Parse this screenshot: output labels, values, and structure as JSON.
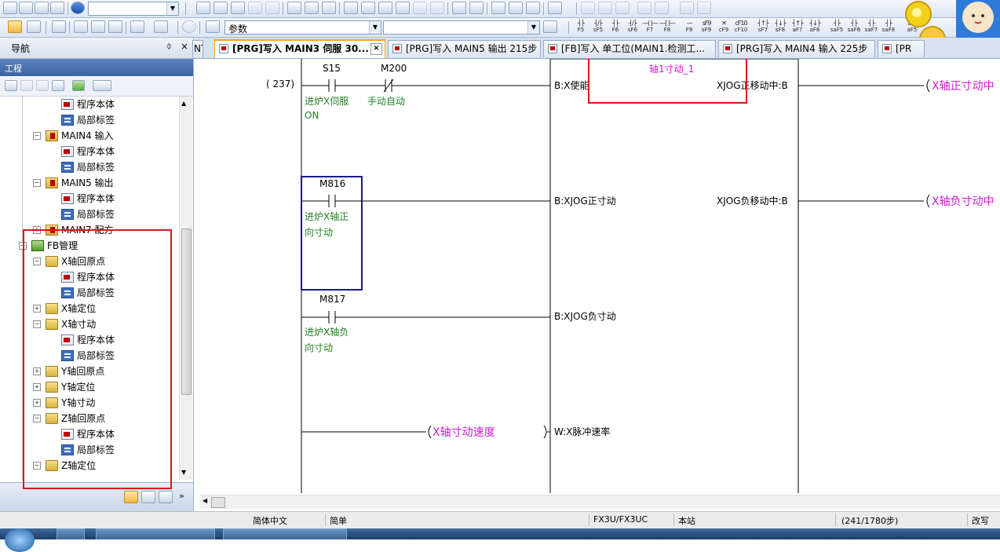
{
  "toolbar": {
    "combo1_value": "",
    "combo2_value": "参数",
    "combo3_value": "",
    "fkeys": [
      "F5",
      "sF5",
      "F6",
      "sF6",
      "F7",
      "F8",
      "F9",
      "sF9",
      "cF9",
      "cF10",
      "sF7",
      "sF8",
      "aF7",
      "aF8",
      "saF5",
      "saF6",
      "saF7",
      "saF8",
      "aF5"
    ]
  },
  "nav": {
    "title": "导航",
    "pin_icon": "pin-icon",
    "close_icon": "close-icon",
    "project_label": "工程",
    "tree": [
      {
        "label": "程序本体",
        "icon": "program-body-icon"
      },
      {
        "label": "局部标签",
        "icon": "local-label-icon"
      },
      {
        "label": "MAIN4 输入",
        "icon": "program-icon"
      },
      {
        "label": "程序本体",
        "icon": "program-body-icon"
      },
      {
        "label": "局部标签",
        "icon": "local-label-icon"
      },
      {
        "label": "MAIN5 输出",
        "icon": "program-icon"
      },
      {
        "label": "程序本体",
        "icon": "program-body-icon"
      },
      {
        "label": "局部标签",
        "icon": "local-label-icon"
      },
      {
        "label": "MAIN7 配方",
        "icon": "program-icon"
      },
      {
        "label": "FB管理",
        "icon": "fb-management-icon"
      },
      {
        "label": "X轴回原点",
        "icon": "folder-icon"
      },
      {
        "label": "程序本体",
        "icon": "program-body-icon"
      },
      {
        "label": "局部标签",
        "icon": "local-label-icon"
      },
      {
        "label": "X轴定位",
        "icon": "folder-icon"
      },
      {
        "label": "X轴寸动",
        "icon": "folder-icon"
      },
      {
        "label": "程序本体",
        "icon": "program-body-icon"
      },
      {
        "label": "局部标签",
        "icon": "local-label-icon"
      },
      {
        "label": "Y轴回原点",
        "icon": "folder-icon"
      },
      {
        "label": "Y轴定位",
        "icon": "folder-icon"
      },
      {
        "label": "Y轴寸动",
        "icon": "folder-icon"
      },
      {
        "label": "Z轴回原点",
        "icon": "folder-icon"
      },
      {
        "label": "程序本体",
        "icon": "program-body-icon"
      },
      {
        "label": "局部标签",
        "icon": "local-label-icon"
      },
      {
        "label": "Z轴定位",
        "icon": "folder-icon"
      }
    ]
  },
  "tabs": [
    {
      "label": "NT",
      "active": false
    },
    {
      "label": "[PRG]写入 MAIN3 伺服 30...",
      "active": true
    },
    {
      "label": "[PRG]写入 MAIN5 输出 215步",
      "active": false
    },
    {
      "label": "[FB]写入 单工位(MAIN1.检测工...",
      "active": false
    },
    {
      "label": "[PRG]写入 MAIN4 输入 225步",
      "active": false
    },
    {
      "label": "[PR",
      "active": false
    }
  ],
  "ladder": {
    "step": "( 237)",
    "contacts": [
      {
        "device": "S15",
        "comment1": "进炉X伺服",
        "comment2": "ON"
      },
      {
        "device": "M200",
        "comment1": "手动自动",
        "comment2": ""
      },
      {
        "device": "M816",
        "comment1": "进炉X轴正",
        "comment2": "向寸动"
      },
      {
        "device": "M817",
        "comment1": "进炉X轴负",
        "comment2": "向寸动"
      }
    ],
    "fb_name": "轴1寸动_1",
    "fb_inputs": [
      "B:X使能",
      "B:XJOG正寸动",
      "B:XJOG负寸动",
      "W:X脉冲速率"
    ],
    "fb_outputs": [
      "XJOG正移动中:B",
      "XJOG负移动中:B"
    ],
    "output_labels": [
      "X轴正寸动中",
      "X轴负寸动中"
    ],
    "input_label": "X轴寸动速度"
  },
  "status": {
    "language": "简体中文",
    "mode": "简单",
    "cpu": "FX3U/FX3UC",
    "station": "本站",
    "steps": "(241/1780步)",
    "edit_mode": "改写"
  }
}
